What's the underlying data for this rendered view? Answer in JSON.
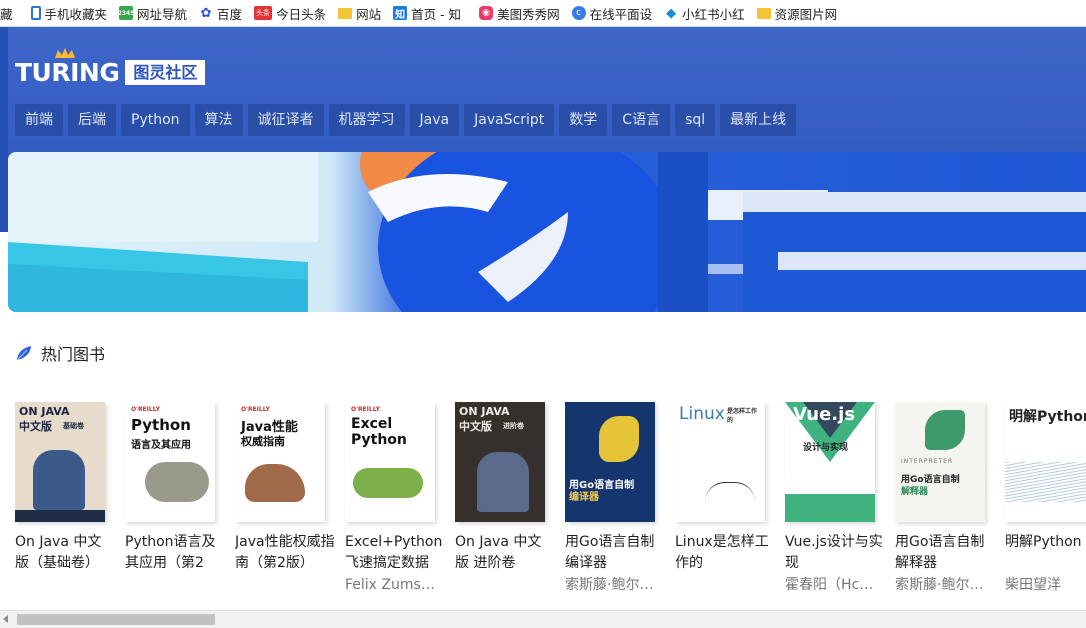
{
  "bookmarks": [
    {
      "label": "藏",
      "icon": "none"
    },
    {
      "label": "手机收藏夹",
      "icon": "phone-icon"
    },
    {
      "label": "网址导航",
      "icon": "2345-icon"
    },
    {
      "label": "百度",
      "icon": "baidu-paw-icon"
    },
    {
      "label": "今日头条",
      "icon": "toutiao-icon",
      "badge": "头条"
    },
    {
      "label": "网站",
      "icon": "folder-icon"
    },
    {
      "label": "首页 - 知",
      "icon": "zhihu-icon",
      "badge": "知"
    },
    {
      "label": "美图秀秀网",
      "icon": "meitu-icon"
    },
    {
      "label": "在线平面设",
      "icon": "design-circle-icon"
    },
    {
      "label": "小红书小红",
      "icon": "xiaohongshu-icon"
    },
    {
      "label": "资源图片网",
      "icon": "folder-icon"
    }
  ],
  "site": {
    "logo_text": "TURING",
    "logo_cn": "图灵社区",
    "brand_color": "#2d56bd"
  },
  "nav": [
    "前端",
    "后端",
    "Python",
    "算法",
    "诚征译者",
    "机器学习",
    "Java",
    "JavaScript",
    "数学",
    "C语言",
    "sql",
    "最新上线"
  ],
  "section": {
    "title": "热门图书"
  },
  "books": [
    {
      "title": "On Java 中文版（基础卷）",
      "author": "",
      "cover": {
        "line1": "ON JAVA",
        "line2": "中文版",
        "line3": "基础卷",
        "bg": "#e7dccb"
      }
    },
    {
      "title": "Python语言及其应用（第2",
      "author": "",
      "cover": {
        "line1": "Python",
        "line2": "语言及其应用",
        "line3": "O'REILLY",
        "bg": "#ffffff"
      }
    },
    {
      "title": "Java性能权威指南（第2版）",
      "author": "",
      "cover": {
        "line1": "Java性能",
        "line2": "权威指南",
        "line3": "O'REILLY",
        "bg": "#ffffff"
      }
    },
    {
      "title": "Excel+Python：飞速搞定数据",
      "author": "Felix Zumstein",
      "cover": {
        "line1": "Excel",
        "line2": "Python",
        "line3": "O'REILLY",
        "bg": "#ffffff"
      }
    },
    {
      "title": "On Java 中文版 进阶卷",
      "author": "",
      "cover": {
        "line1": "ON JAVA",
        "line2": "中文版",
        "line3": "进阶卷",
        "bg": "#35302c"
      }
    },
    {
      "title": "用Go语言自制编译器",
      "author": "索斯藤·鲍尔…",
      "cover": {
        "line1": "用Go语言自制",
        "line2": "编译器",
        "line3": "",
        "bg": "#14356e"
      }
    },
    {
      "title": "Linux是怎样工作的",
      "author": "",
      "cover": {
        "line1": "Linux",
        "line2": "是怎样工作的",
        "line3": "",
        "bg": "#ffffff"
      }
    },
    {
      "title": "Vue.js设计与实现",
      "author": "霍春阳（Hcy…",
      "cover": {
        "line1": "Vue.js",
        "line2": "设计与实现",
        "line3": "",
        "bg": "#ffffff"
      }
    },
    {
      "title": "用Go语言自制解释器",
      "author": "索斯藤·鲍尔…",
      "cover": {
        "line1": "用Go语言自制",
        "line2": "解释器",
        "line3": "INTERPRETER",
        "bg": "#f5f5f0"
      }
    },
    {
      "title": "明解Python",
      "author": "柴田望洋",
      "cover": {
        "line1": "明解Python",
        "line2": "",
        "line3": "",
        "bg": "#ffffff"
      }
    }
  ]
}
